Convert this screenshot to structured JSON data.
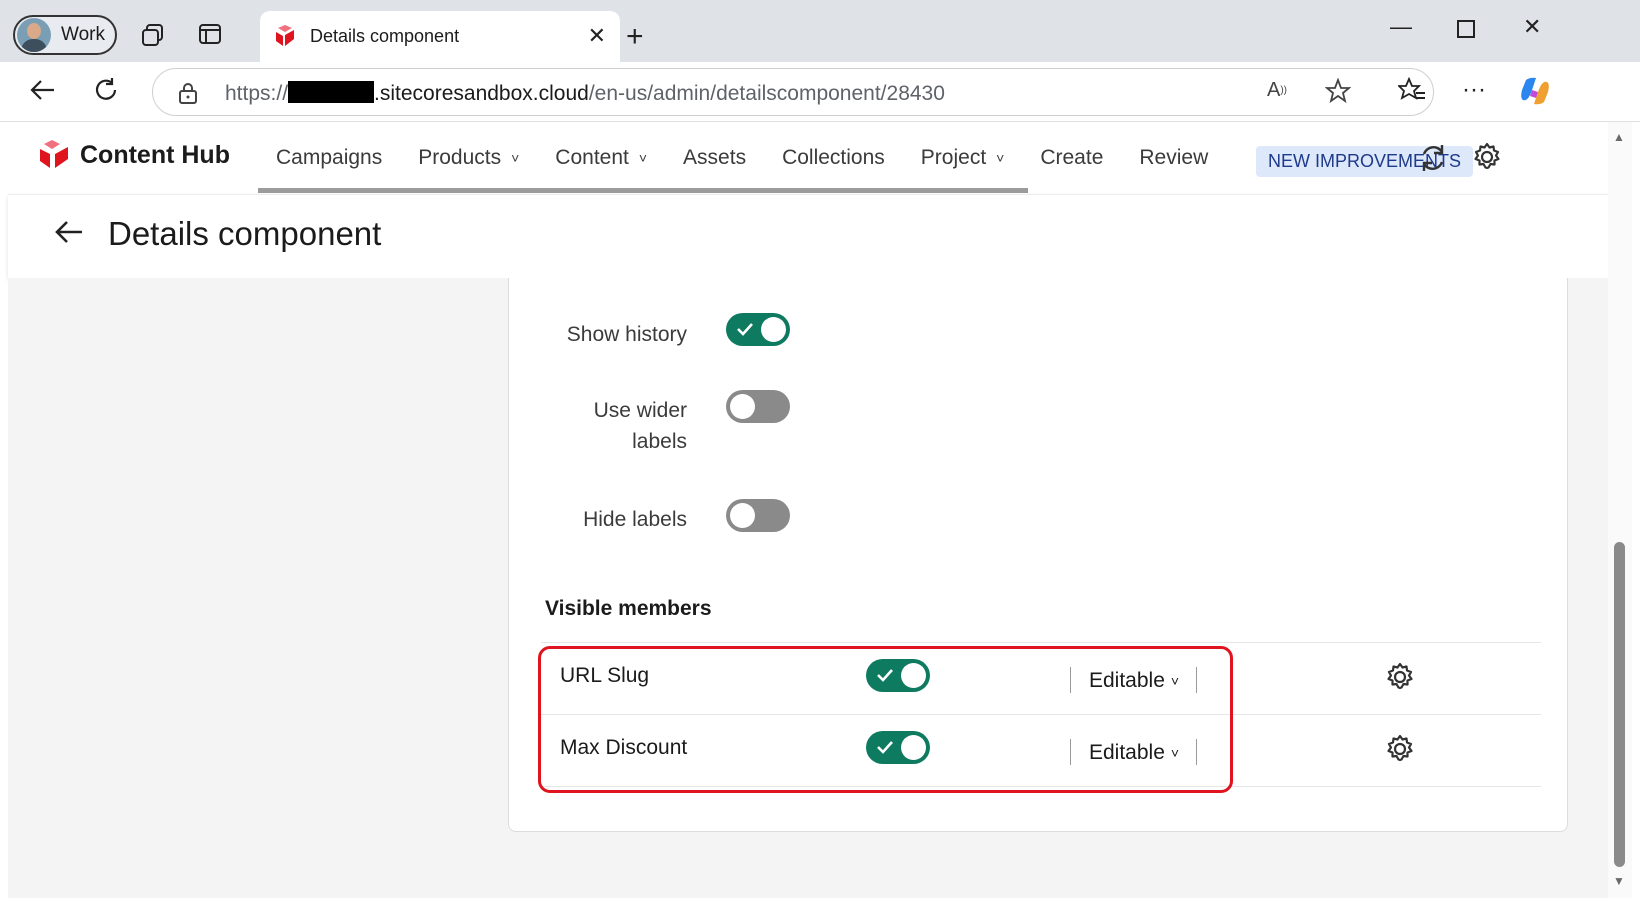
{
  "browser": {
    "profile_label": "Work",
    "tab_title": "Details component",
    "url_prefix": "https://",
    "url_domain": ".sitecoresandbox.cloud",
    "url_path": "/en-us/admin/detailscomponent/28430"
  },
  "app": {
    "brand": "Content Hub",
    "nav": [
      {
        "label": "Campaigns",
        "has_dropdown": false
      },
      {
        "label": "Products",
        "has_dropdown": true
      },
      {
        "label": "Content",
        "has_dropdown": true
      },
      {
        "label": "Assets",
        "has_dropdown": false
      },
      {
        "label": "Collections",
        "has_dropdown": false
      },
      {
        "label": "Project",
        "has_dropdown": true
      },
      {
        "label": "Create",
        "has_dropdown": false
      },
      {
        "label": "Review",
        "has_dropdown": false
      }
    ],
    "badge": "NEW IMPROVEMENTS"
  },
  "page": {
    "title": "Details component"
  },
  "options": {
    "show_history": {
      "label": "Show history",
      "checked": true
    },
    "use_wider_labels": {
      "label_line1": "Use wider",
      "label_line2": "labels",
      "checked": false
    },
    "hide_labels": {
      "label": "Hide labels",
      "checked": false
    }
  },
  "visible_members": {
    "title": "Visible members",
    "rows": [
      {
        "name": "URL Slug",
        "visible": true,
        "mode": "Editable"
      },
      {
        "name": "Max Discount",
        "visible": true,
        "mode": "Editable"
      }
    ]
  },
  "colors": {
    "toggle_on": "#0e7a60",
    "toggle_off": "#8a8a8a",
    "brand_red": "#e0141e",
    "badge_bg": "#dde8fb"
  }
}
